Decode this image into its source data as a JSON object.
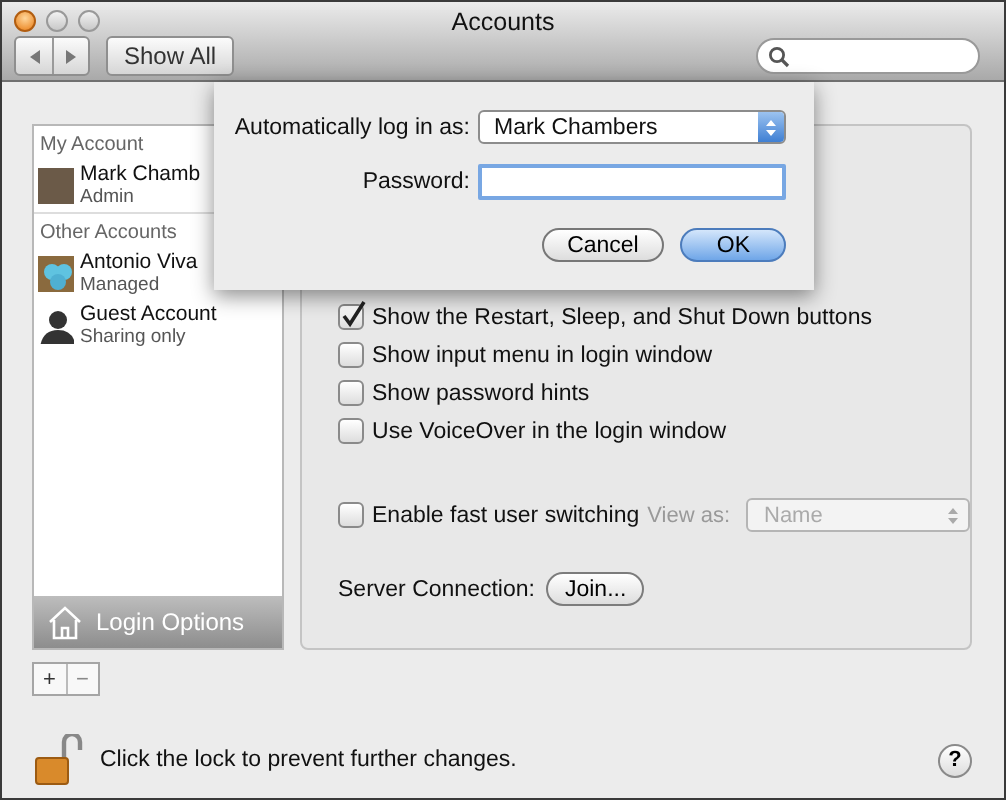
{
  "window": {
    "title": "Accounts",
    "show_all": "Show All"
  },
  "sidebar": {
    "groups": [
      {
        "header": "My Account",
        "accounts": [
          {
            "name": "Mark Chamb",
            "role": "Admin",
            "kind": "photo",
            "selected": false
          }
        ]
      },
      {
        "header": "Other Accounts",
        "accounts": [
          {
            "name": "Antonio Viva",
            "role": "Managed",
            "kind": "picture",
            "selected": false
          },
          {
            "name": "Guest Account",
            "role": "Sharing only",
            "kind": "silhouette",
            "selected": false
          }
        ]
      }
    ],
    "login_options": {
      "label": "Login Options",
      "selected": true
    }
  },
  "options": [
    {
      "label": "Show the Restart, Sleep, and Shut Down buttons",
      "checked": true
    },
    {
      "label": "Show input menu in login window",
      "checked": false
    },
    {
      "label": "Show password hints",
      "checked": false
    },
    {
      "label": "Use VoiceOver in the login window",
      "checked": false
    }
  ],
  "fast_switching": {
    "label": "Enable fast user switching",
    "checked": false,
    "view_as_label": "View as:",
    "view_as_value": "Name",
    "disabled": true
  },
  "server_connection": {
    "label": "Server Connection:",
    "button": "Join..."
  },
  "sheet": {
    "autologin_label": "Automatically log in as:",
    "autologin_value": "Mark Chambers",
    "password_label": "Password:",
    "buttons": [
      {
        "label": "Cancel",
        "default": false
      },
      {
        "label": "OK",
        "default": true
      }
    ]
  },
  "add_remove": [
    "+",
    "−"
  ],
  "lock": {
    "text": "Click the lock to prevent further changes.",
    "locked": false
  },
  "help": "?"
}
